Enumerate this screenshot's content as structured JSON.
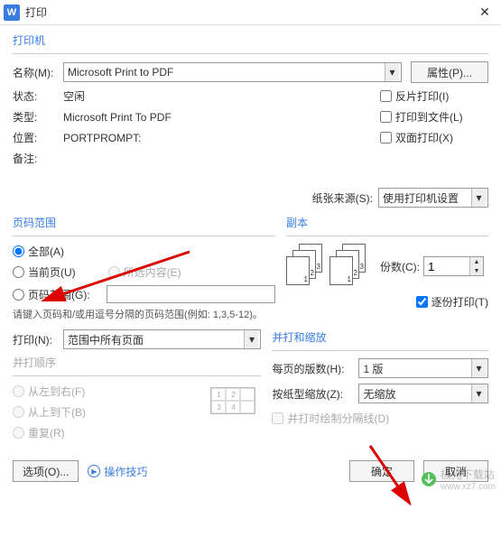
{
  "titlebar": {
    "title": "打印"
  },
  "printer": {
    "section": "打印机",
    "name_label": "名称(M):",
    "name_value": "Microsoft Print to PDF",
    "properties_btn": "属性(P)...",
    "status_label": "状态:",
    "status_value": "空闲",
    "type_label": "类型:",
    "type_value": "Microsoft Print To PDF",
    "where_label": "位置:",
    "where_value": "PORTPROMPT:",
    "comment_label": "备注:",
    "reverse": "反片打印(I)",
    "tofile": "打印到文件(L)",
    "duplex": "双面打印(X)",
    "paper_source_label": "纸张来源(S):",
    "paper_source_value": "使用打印机设置"
  },
  "range": {
    "legend": "页码范围",
    "all": "全部(A)",
    "current": "当前页(U)",
    "selection": "所选内容(E)",
    "pages": "页码范围(G):",
    "hint": "请键入页码和/或用逗号分隔的页码范围(例如: 1,3,5-12)。"
  },
  "copies": {
    "legend": "副本",
    "copies_label": "份数(C):",
    "copies_value": "1",
    "collate": "逐份打印(T)"
  },
  "print_what": {
    "label": "打印(N):",
    "value": "范围中所有页面"
  },
  "order": {
    "legend": "并打顺序",
    "lr": "从左到右(F)",
    "tb": "从上到下(B)",
    "repeat": "重复(R)"
  },
  "scale": {
    "legend": "并打和缩放",
    "per_page_label": "每页的版数(H):",
    "per_page_value": "1 版",
    "scale_label": "按纸型缩放(Z):",
    "scale_value": "无缩放",
    "draw_lines": "并打时绘制分隔线(D)"
  },
  "footer": {
    "options": "选项(O)...",
    "tips": "操作技巧",
    "ok": "确定",
    "cancel": "取消"
  },
  "watermark": {
    "site": "极光下载站",
    "url": "www.xz7.com"
  }
}
